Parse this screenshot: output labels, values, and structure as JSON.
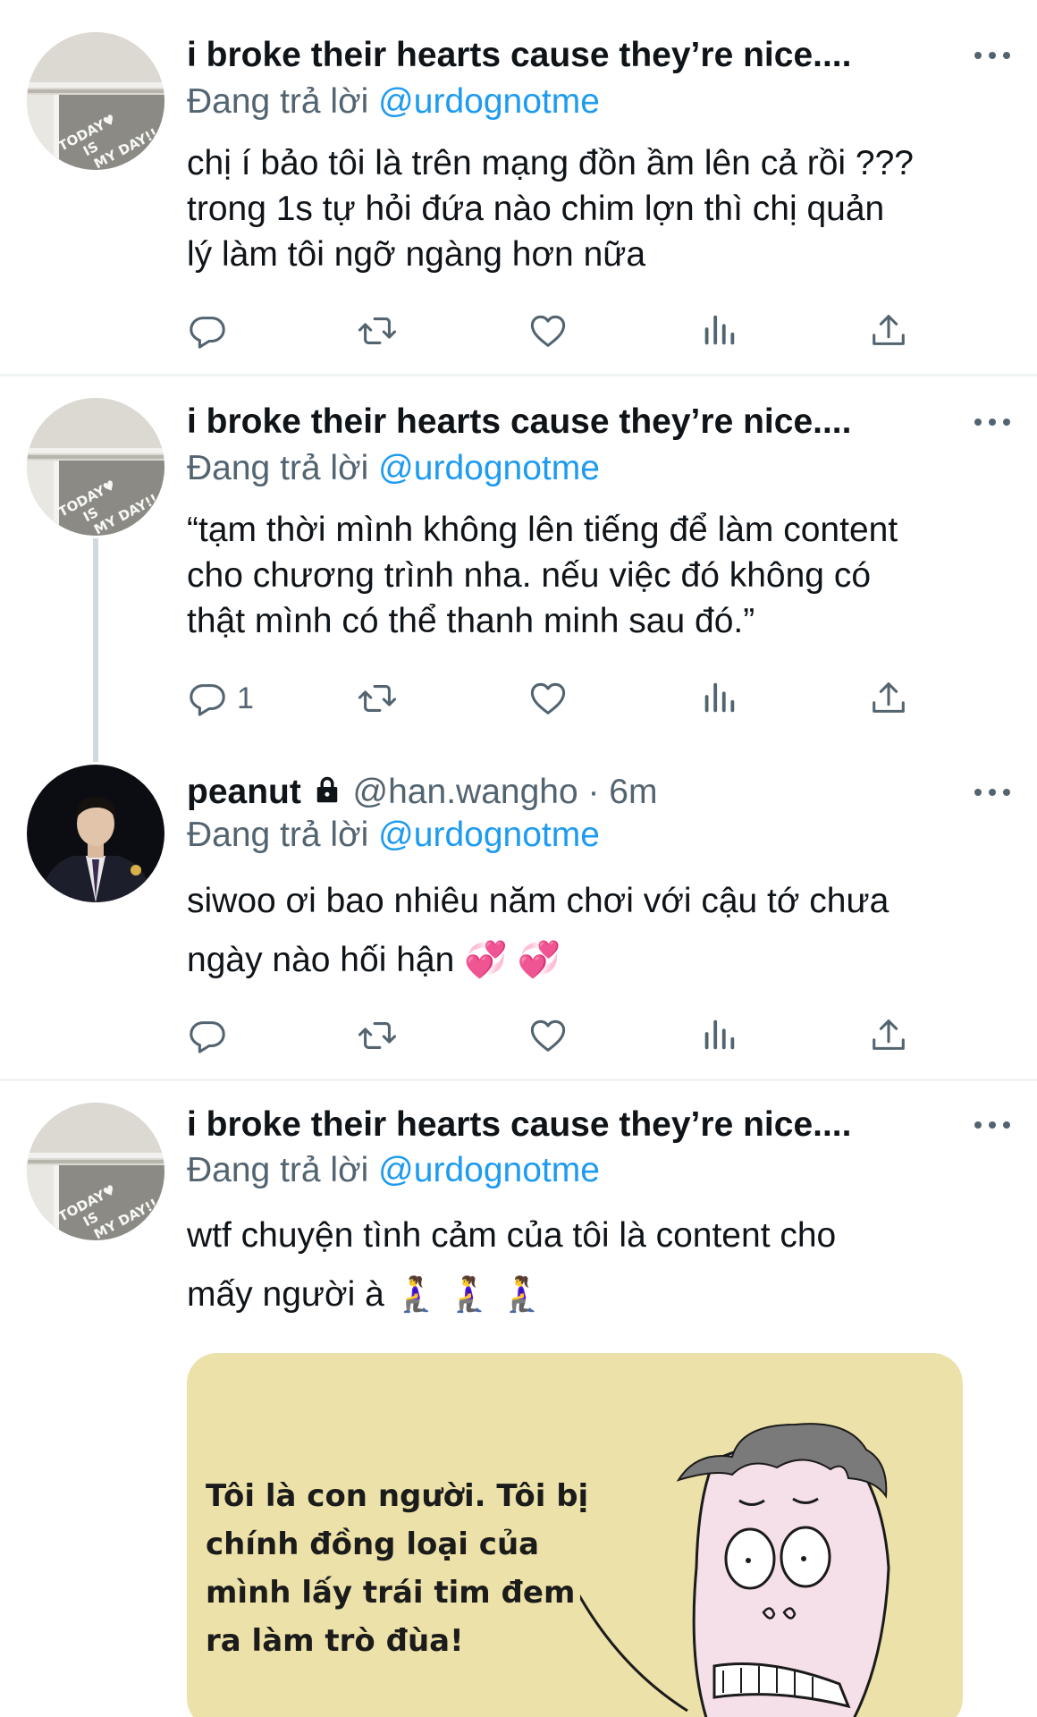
{
  "tweets": [
    {
      "name": "i broke their hearts cause they’re nice....",
      "reply_prefix": "Đang trả lời",
      "reply_mention": "@urdognotme",
      "body_lines": [
        "chị í bảo tôi là trên mạng đồn ầm lên cả rồi ???",
        "trong 1s tự hỏi đứa nào chim lợn thì chị quản",
        "lý làm tôi ngỡ ngàng hơn nữa"
      ],
      "reply_count": "",
      "avatar": "today-is-day-photo"
    },
    {
      "name": "i broke their hearts cause they’re nice....",
      "reply_prefix": "Đang trả lời",
      "reply_mention": "@urdognotme",
      "body_lines": [
        "“tạm thời mình không lên tiếng để làm content",
        "cho chương trình nha. nếu việc đó không có",
        "thật mình có thể thanh minh sau đó.”"
      ],
      "reply_count": "1",
      "avatar": "today-is-day-photo"
    },
    {
      "name": "peanut",
      "handle": "@han.wangho · 6m",
      "reply_prefix": "Đang trả lời",
      "reply_mention": "@urdognotme",
      "body_lines": [
        "siwoo ơi bao nhiêu năm chơi với cậu tớ chưa",
        "ngày nào hối hận 💞 💞"
      ],
      "reply_count": "",
      "avatar": "man-in-suit-photo"
    },
    {
      "name": "i broke their hearts cause they’re nice....",
      "reply_prefix": "Đang trả lời",
      "reply_mention": "@urdognotme",
      "body_lines": [
        "wtf chuyện tình cảm của tôi là content cho",
        "mấy người à 🧎‍♀️ 🧎‍♀️ 🧎‍♀️"
      ],
      "avatar": "today-is-day-photo",
      "media": {
        "text_lines": [
          "Tôi là con người. Tôi bị",
          "chính đồng loại của",
          "mình lấy trái tim đem",
          "ra làm trò đùa!"
        ],
        "image": "cartoon-face-meme"
      }
    }
  ],
  "avatar_art_text": [
    "TODAY♥",
    "IS",
    "MY DAY!!"
  ],
  "icons": [
    "reply-icon",
    "retweet-icon",
    "like-icon",
    "views-icon",
    "share-icon",
    "more-icon",
    "lock-icon"
  ],
  "colors": {
    "link": "#1d9bf0",
    "secondary_text": "#536471",
    "separator": "#eff3f4",
    "thread_line": "#cfd9de",
    "meme_bg": "#ece1a8"
  }
}
